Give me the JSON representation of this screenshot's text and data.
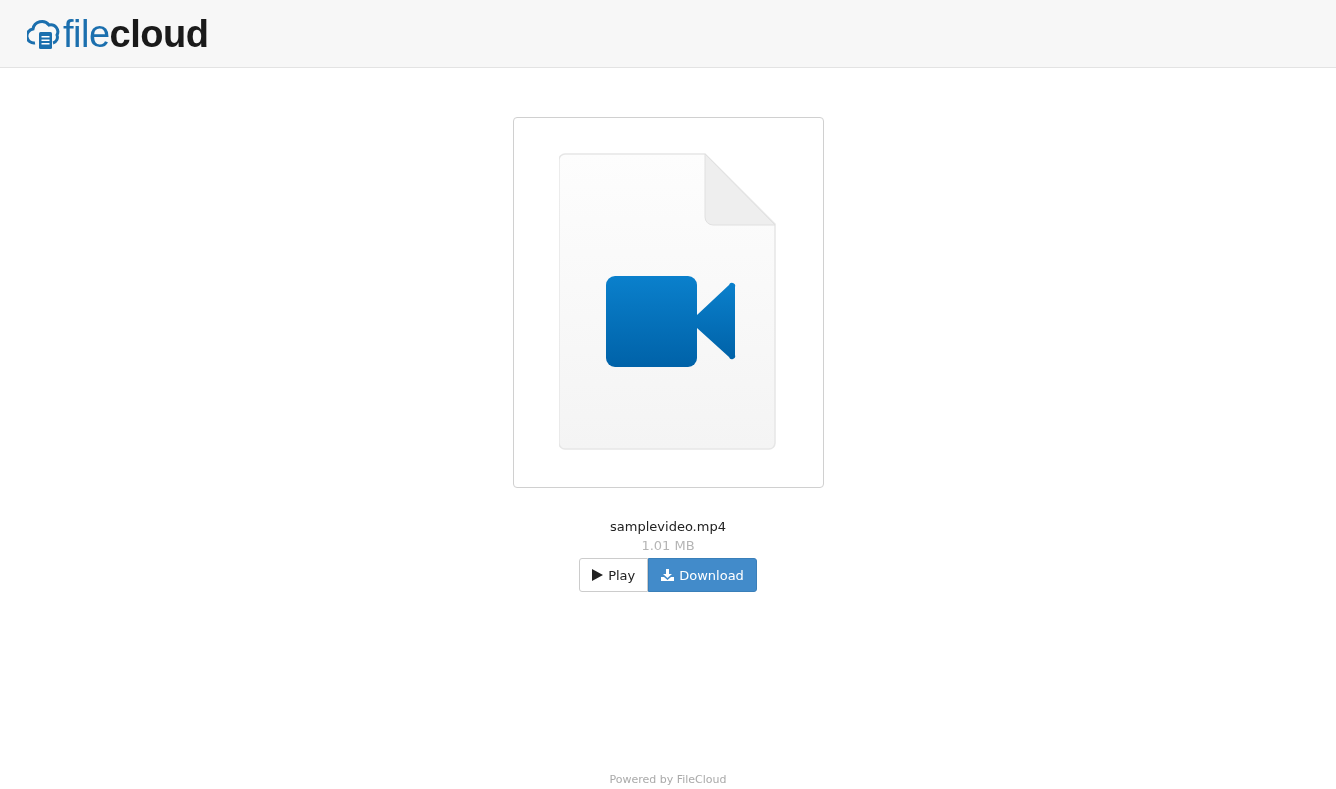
{
  "header": {
    "logo": {
      "light_part": "file",
      "bold_part": "cloud"
    }
  },
  "file": {
    "name": "samplevideo.mp4",
    "size": "1.01 MB"
  },
  "buttons": [
    {
      "kind": "play",
      "label": "Play"
    },
    {
      "kind": "download",
      "label": "Download"
    }
  ],
  "footer": {
    "text": "Powered by FileCloud"
  }
}
